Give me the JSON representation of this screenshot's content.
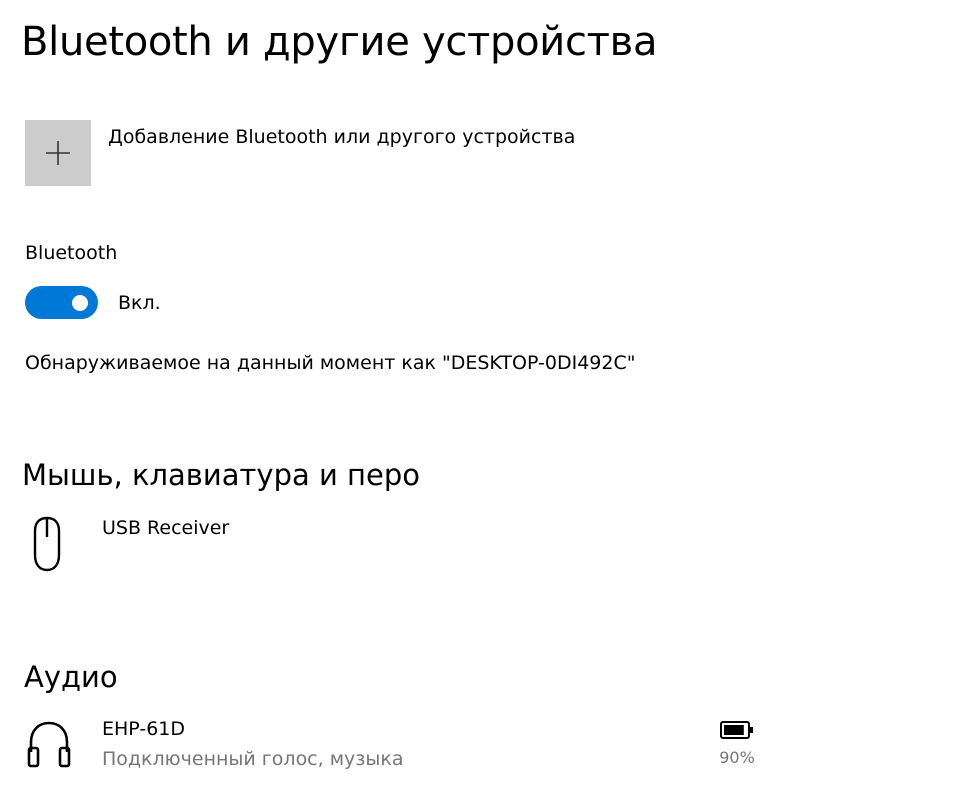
{
  "page": {
    "title": "Bluetooth и другие устройства"
  },
  "add_device": {
    "label": "Добавление Bluetooth или другого устройства",
    "icon": "plus-icon"
  },
  "bluetooth": {
    "label": "Bluetooth",
    "toggle_on": true,
    "toggle_label": "Вкл.",
    "discoverable_text": "Обнаруживаемое на данный момент как \"DESKTOP-0DI492C\""
  },
  "sections": {
    "mouse_keyboard_pen": {
      "title": "Мышь, клавиатура и перо",
      "devices": [
        {
          "name": "USB Receiver",
          "icon": "mouse-icon"
        }
      ]
    },
    "audio": {
      "title": "Аудио",
      "devices": [
        {
          "name": "EHP-61D",
          "status": "Подключенный голос, музыка",
          "icon": "headphones-icon",
          "battery": "90%",
          "battery_level": 0.9
        }
      ]
    }
  },
  "colors": {
    "accent": "#0078d7",
    "tile_bg": "#cccccc",
    "secondary_text": "#767676"
  }
}
